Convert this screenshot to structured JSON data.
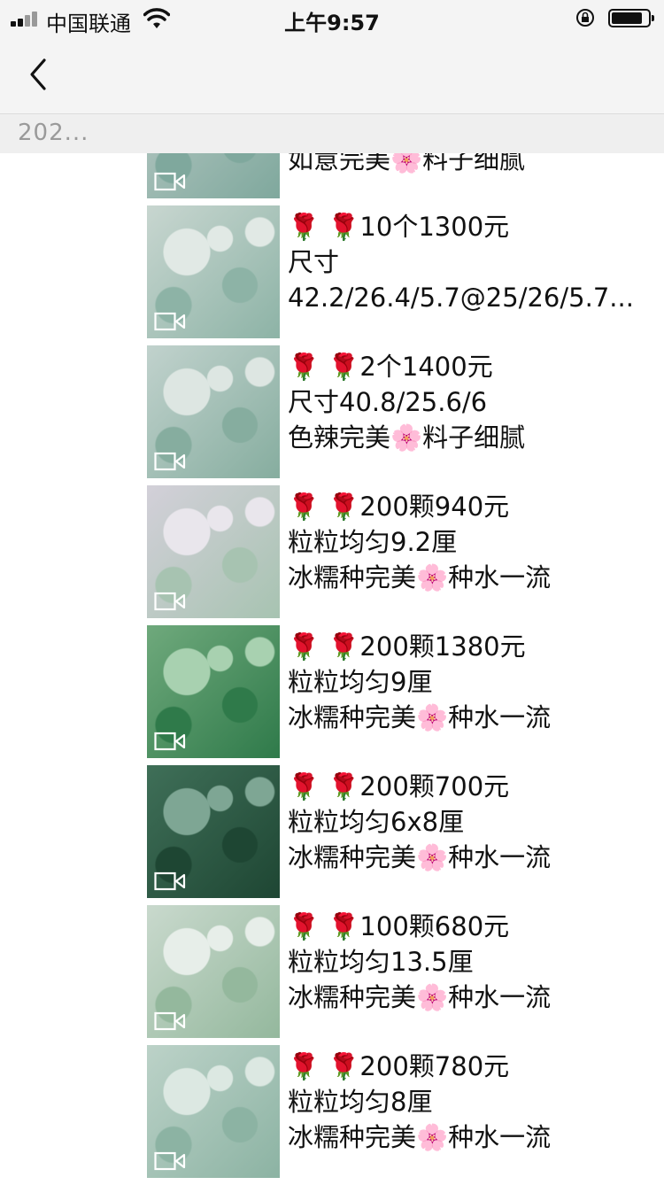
{
  "status_bar": {
    "carrier": "中国联通",
    "time": "上午9:57"
  },
  "album": {
    "title": "202..."
  },
  "posts": [
    {
      "lines": [
        "如意完美🌸料子细腻"
      ],
      "thumb_colors": [
        "#b8c9c4",
        "#7fa89d",
        "#c9d8d2"
      ]
    },
    {
      "lines": [
        "🌹 🌹10个1300元",
        "尺寸",
        "42.2/26.4/5.7@25/26/5.7..."
      ],
      "thumb_colors": [
        "#c8d6d0",
        "#8db3a6",
        "#e1e9e5"
      ]
    },
    {
      "lines": [
        "🌹 🌹2个1400元",
        "尺寸40.8/25.6/6",
        "色辣完美🌸料子细腻"
      ],
      "thumb_colors": [
        "#c1d2cd",
        "#86ad9f",
        "#dde6e2"
      ]
    },
    {
      "lines": [
        "🌹 🌹200颗940元",
        "粒粒均匀9.2厘",
        "冰糯种完美🌸种水一流"
      ],
      "thumb_colors": [
        "#d3d0d9",
        "#a7c3b1",
        "#e9e6ec"
      ]
    },
    {
      "lines": [
        "🌹 🌹200颗1380元",
        "粒粒均匀9厘",
        "冰糯种完美🌸种水一流"
      ],
      "thumb_colors": [
        "#6fa97c",
        "#2f7a4a",
        "#a8d1b0"
      ]
    },
    {
      "lines": [
        "🌹 🌹200颗700元",
        "粒粒均匀6x8厘",
        "冰糯种完美🌸种水一流"
      ],
      "thumb_colors": [
        "#3f6f58",
        "#1e4633",
        "#7ea694"
      ]
    },
    {
      "lines": [
        "🌹 🌹100颗680元",
        "粒粒均匀13.5厘",
        "冰糯种完美🌸种水一流"
      ],
      "thumb_colors": [
        "#c9d9cd",
        "#94b89d",
        "#e7eee9"
      ]
    },
    {
      "lines": [
        "🌹 🌹200颗780元",
        "粒粒均匀8厘",
        "冰糯种完美🌸种水一流"
      ],
      "thumb_colors": [
        "#bcd2c8",
        "#8cb3a3",
        "#dce8e2"
      ]
    }
  ]
}
